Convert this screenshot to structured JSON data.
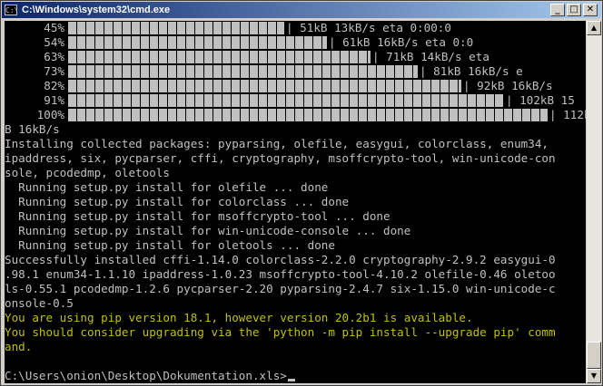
{
  "window": {
    "title": "C:\\Windows\\system32\\cmd.exe",
    "icon_text": "C:\\",
    "icons": {
      "minimize": "minimize-icon",
      "maximize": "maximize-icon",
      "close": "close-icon"
    },
    "buttons": {
      "minimize": "_",
      "maximize": "□",
      "close": "✕"
    }
  },
  "progress": [
    {
      "percent": "45%",
      "fraction": 0.45,
      "stat": "| 51kB 13kB/s eta 0:00:0"
    },
    {
      "percent": "54%",
      "fraction": 0.54,
      "stat": "| 61kB 16kB/s eta 0:0"
    },
    {
      "percent": "63%",
      "fraction": 0.63,
      "stat": "| 71kB 14kB/s eta"
    },
    {
      "percent": "73%",
      "fraction": 0.73,
      "stat": "| 81kB 16kB/s e"
    },
    {
      "percent": "82%",
      "fraction": 0.82,
      "stat": "| 92kB 16kB/s"
    },
    {
      "percent": "91%",
      "fraction": 0.91,
      "stat": "| 102kB 15"
    },
    {
      "percent": "100%",
      "fraction": 1.0,
      "stat": "| 112k"
    }
  ],
  "output_lines": [
    "B 16kB/s",
    "Installing collected packages: pyparsing, olefile, easygui, colorclass, enum34,",
    "ipaddress, six, pycparser, cffi, cryptography, msoffcrypto-tool, win-unicode-con",
    "sole, pcodedmp, oletools",
    "  Running setup.py install for olefile ... done",
    "  Running setup.py install for colorclass ... done",
    "  Running setup.py install for msoffcrypto-tool ... done",
    "  Running setup.py install for win-unicode-console ... done",
    "  Running setup.py install for oletools ... done",
    "Successfully installed cffi-1.14.0 colorclass-2.2.0 cryptography-2.9.2 easygui-0",
    ".98.1 enum34-1.1.10 ipaddress-1.0.23 msoffcrypto-tool-4.10.2 olefile-0.46 oletoo",
    "ls-0.55.1 pcodedmp-1.2.6 pycparser-2.20 pyparsing-2.4.7 six-1.15.0 win-unicode-c",
    "onsole-0.5"
  ],
  "warning_lines": [
    "You are using pip version 18.1, however version 20.2b1 is available.",
    "You should consider upgrading via the 'python -m pip install --upgrade pip' comm",
    "and."
  ],
  "prompt": "C:\\Users\\onion\\Desktop\\Dokumentation.xls>",
  "scrollbar": {
    "up": "▲",
    "down": "▼"
  },
  "colors": {
    "console_bg": "#000000",
    "text": "#c0c0c0",
    "warning": "#c0c000"
  }
}
